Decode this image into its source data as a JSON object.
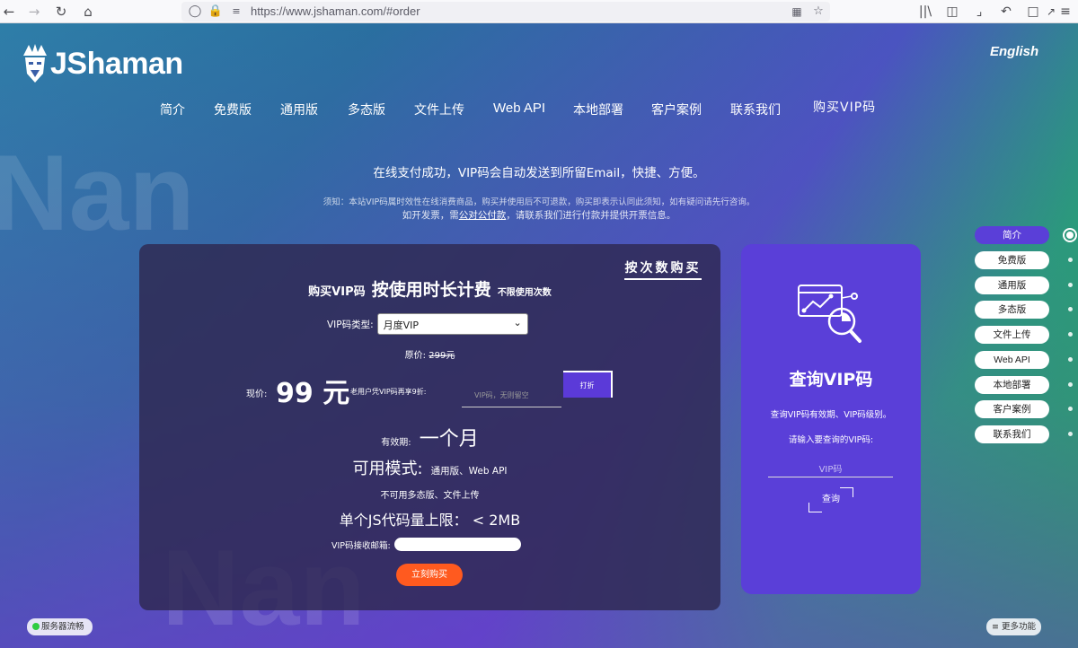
{
  "browser": {
    "url": "https://www.jshaman.com/#order",
    "nav_icons": [
      "back-arrow-icon",
      "forward-arrow-icon",
      "reload-icon",
      "home-icon"
    ],
    "url_icons": [
      "shield-icon",
      "lock-icon",
      "permissions-icon"
    ],
    "right_icons": [
      "qr-code-icon",
      "bookmark-star-icon",
      "library-icon",
      "sidebar-icon",
      "crop-icon",
      "undo-icon",
      "extensions-icon",
      "share-icon",
      "menu-icon"
    ]
  },
  "header": {
    "logo_text": "JShaman",
    "lang": "English"
  },
  "nav": {
    "items": [
      "简介",
      "免费版",
      "通用版",
      "多态版",
      "文件上传",
      "Web API",
      "本地部署",
      "客户案例",
      "联系我们",
      "购买VIP码"
    ]
  },
  "notice": {
    "line1": "在线支付成功，VIP码会自动发送到所留Email，快捷、方便。",
    "line2": "须知：本站VIP码属时效性在线消费商品，购买并使用后不可退款，购买即表示认同此须知，如有疑问请先行咨询。",
    "line3_prefix": "如开发票，需",
    "line3_link": "公对公付款",
    "line3_suffix": "，请联系我们进行付款并提供开票信息。"
  },
  "order": {
    "tab": "按次数购买",
    "title_prefix": "购买VIP码",
    "title_main": "按使用时长计费",
    "title_suffix": "不限使用次数",
    "type_label": "VIP码类型:",
    "type_value": "月度VIP",
    "orig_label": "原价:",
    "orig_price": "299元",
    "now_label": "现价:",
    "now_price": "99 元",
    "discount_note": "老用户凭VIP码再享9折:",
    "discount_placeholder": "VIP码，无则留空",
    "discount_button": "打折",
    "valid_label": "有效期:",
    "valid_value": "一个月",
    "mode_label": "可用模式:",
    "mode_value": "通用版、Web API",
    "no_mode": "不可用多态版、文件上传",
    "limit": "单个JS代码量上限： < 2MB",
    "email_label": "VIP码接收邮箱:",
    "buy_button": "立刻购买"
  },
  "query": {
    "title": "查询VIP码",
    "desc": "查询VIP码有效期、VIP码级别。",
    "input_label": "请输入要查询的VIP码:",
    "placeholder": "VIP码",
    "button": "查询"
  },
  "sidenav": {
    "items": [
      "简介",
      "免费版",
      "通用版",
      "多态版",
      "文件上传",
      "Web API",
      "本地部署",
      "客户案例",
      "联系我们"
    ],
    "active_index": 0
  },
  "footer": {
    "status": "服务器流畅",
    "more": "≡ 更多功能"
  },
  "colors": {
    "accent": "#5a3fd8",
    "buy": "#ff5a1f",
    "status_ok": "#2ecc40"
  }
}
